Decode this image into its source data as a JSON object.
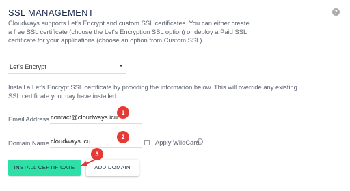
{
  "header": {
    "title": "SSL MANAGEMENT",
    "help_icon_glyph": "?"
  },
  "intro_text": "Cloudways supports Let's Encrypt and custom SSL certificates. You can either create a free SSL certificate (choose the Let's Encryption SSL option) or deploy a Paid SSL certificate for your applications (choose an option from Custom SSL).",
  "certificate_type": {
    "selected": "Let's Encrypt"
  },
  "info_text": "Install a Let's Encrypt SSL certificate by providing the information below. This will override any existing SSL certificate you may have installed.",
  "form": {
    "email_label": "Email Address",
    "email_value": "contact@cloudways.icu",
    "domain_label": "Domain Name",
    "domain_value": "cloudways.icu",
    "wildcard_label": "Apply WildCard",
    "wildcard_checked": false,
    "wildcard_info_glyph": "i"
  },
  "buttons": {
    "install": "INSTALL CERTIFICATE",
    "add_domain": "ADD DOMAIN"
  },
  "annotations": {
    "step1": "1",
    "step2": "2",
    "step3": "3",
    "color": "#e53935"
  },
  "colors": {
    "accent": "#2ee0a6",
    "title": "#1b2a4e",
    "annotation": "#e53935"
  }
}
